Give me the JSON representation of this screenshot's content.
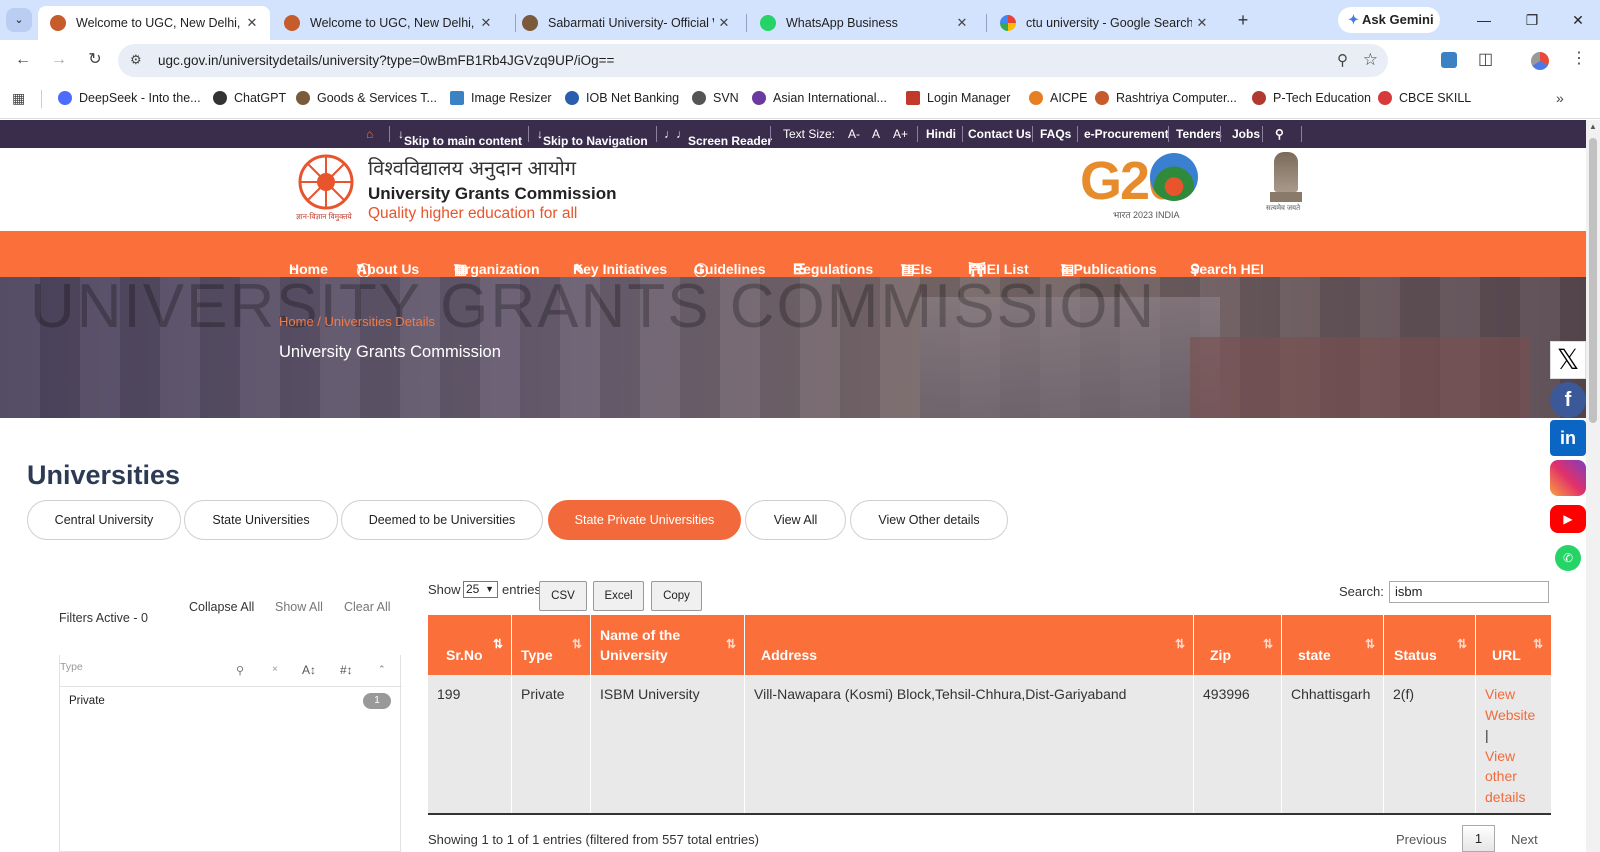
{
  "browser": {
    "tabs": [
      {
        "title": "Welcome to UGC, New Delhi, In",
        "active": true
      },
      {
        "title": "Welcome to UGC, New Delhi, In",
        "active": false
      },
      {
        "title": "Sabarmati University- Official W",
        "active": false
      },
      {
        "title": "WhatsApp Business",
        "active": false
      },
      {
        "title": "ctu university - Google Search",
        "active": false
      }
    ],
    "ask_gemini": "Ask Gemini",
    "url": "ugc.gov.in/universitydetails/university?type=0wBmFB1Rb4JGVzq9UP/iOg==",
    "bookmarks": [
      "DeepSeek - Into the...",
      "ChatGPT",
      "Goods & Services T...",
      "Image Resizer",
      "IOB Net Banking",
      "SVN",
      "Asian International...",
      "Login Manager",
      "AICPE",
      "Rashtriya Computer...",
      "P-Tech Education",
      "CBCE SKILL"
    ]
  },
  "topbar": {
    "skip_main": "Skip to main content",
    "skip_nav": "Skip to Navigation",
    "screen_reader": "Screen Reader",
    "text_size": "Text Size:",
    "size_small": "A-",
    "size_normal": "A",
    "size_large": "A+",
    "links": [
      "Hindi",
      "Contact Us",
      "FAQs",
      "e-Procurement",
      "Tenders",
      "Jobs"
    ]
  },
  "header": {
    "hindi_name": "विश्वविद्यालय अनुदान आयोग",
    "english_name": "University Grants Commission",
    "tagline": "Quality higher education for all",
    "logo_caption": "ज्ञान-विज्ञान विमुक्तये",
    "g20_text": "G20",
    "g20_caption": "भारत 2023 INDIA",
    "emblem_caption": "सत्यमेव जयते"
  },
  "mainnav": [
    "Home",
    "About Us",
    "Organization",
    "Key Initiatives",
    "Guidelines",
    "Regulations",
    "HEIs",
    "FHEI List",
    "e-Publications",
    "Search HEI"
  ],
  "banner": {
    "breadcrumb": "Home / Universities Details",
    "title": "University Grants Commission",
    "bg_text": "UNIVERSITY GRANTS COMMISSION"
  },
  "page": {
    "title": "Universities",
    "categories": [
      "Central University",
      "State Universities",
      "Deemed to be Universities",
      "State Private Universities",
      "View All",
      "View Other details"
    ],
    "selected_category": "State Private Universities"
  },
  "filters": {
    "active": "Filters Active - 0",
    "collapse": "Collapse All",
    "show_all": "Show All",
    "clear_all": "Clear All",
    "type_label": "Type",
    "item": "Private",
    "item_count": "1"
  },
  "table": {
    "show": "Show",
    "entries_value": "25",
    "entries": "entries",
    "buttons": [
      "CSV",
      "Excel",
      "Copy"
    ],
    "search_label": "Search:",
    "search_value": "isbm",
    "headers": [
      "Sr.No",
      "Type",
      "Name of the University",
      "Address",
      "Zip",
      "state",
      "Status",
      "URL"
    ],
    "row": {
      "srno": "199",
      "type": "Private",
      "name": "ISBM University",
      "address": "Vill-Nawapara (Kosmi) Block,Tehsil-Chhura,Dist-Gariyaband",
      "zip": "493996",
      "state": "Chhattisgarh",
      "status": "2(f)",
      "url_1": "View Website",
      "url_sep": "|",
      "url_2": "View other details"
    },
    "info": "Showing 1 to 1 of 1 entries (filtered from 557 total entries)",
    "prev": "Previous",
    "page": "1",
    "next": "Next"
  },
  "colors": {
    "accent": "#fb6f3a",
    "topbar": "#3a2d4c",
    "chrome_tabs": "#d3e3fd"
  }
}
